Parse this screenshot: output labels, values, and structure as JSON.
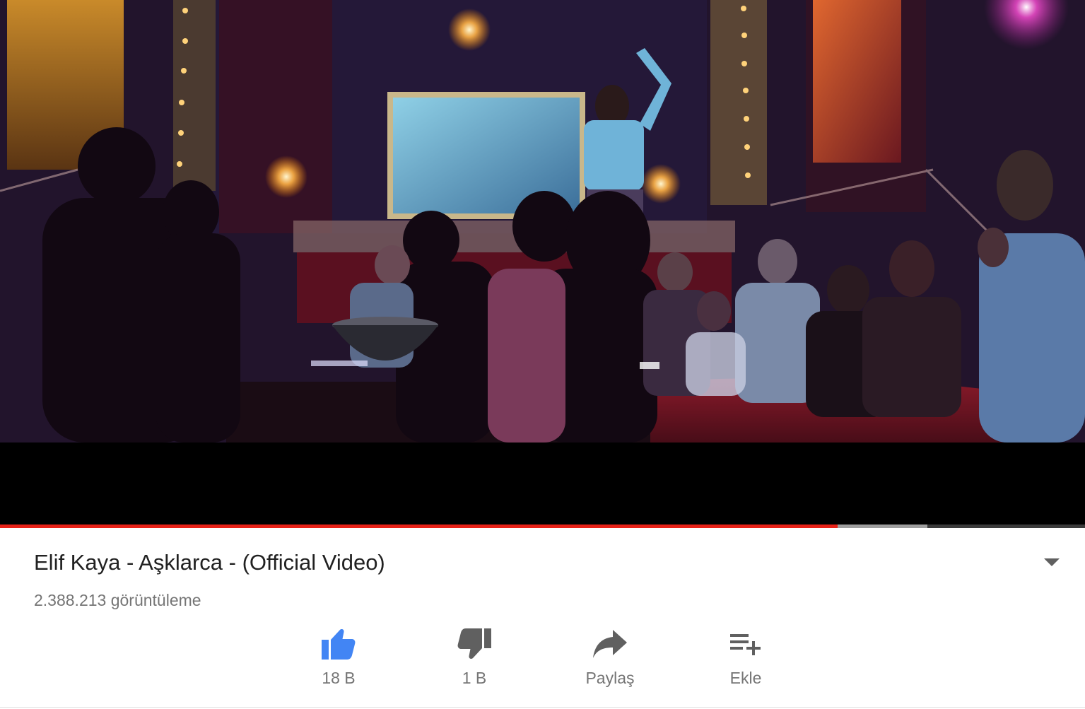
{
  "video": {
    "progress_played_fraction": 0.772,
    "progress_buffered_fraction": 0.855
  },
  "colors": {
    "progress_played": "#e62117",
    "like_active": "#4285f4",
    "icon_gray": "#606060",
    "secondary_text": "#757575"
  },
  "info": {
    "title": "Elif Kaya - Aşklarca - (Official Video)",
    "views": "2.388.213 görüntüleme",
    "expand_icon": "chevron-down-icon"
  },
  "actions": {
    "like": {
      "icon": "thumbs-up-icon",
      "label": "18 B"
    },
    "dislike": {
      "icon": "thumbs-down-icon",
      "label": "1 B"
    },
    "share": {
      "icon": "share-icon",
      "label": "Paylaş"
    },
    "add": {
      "icon": "playlist-add-icon",
      "label": "Ekle"
    }
  }
}
